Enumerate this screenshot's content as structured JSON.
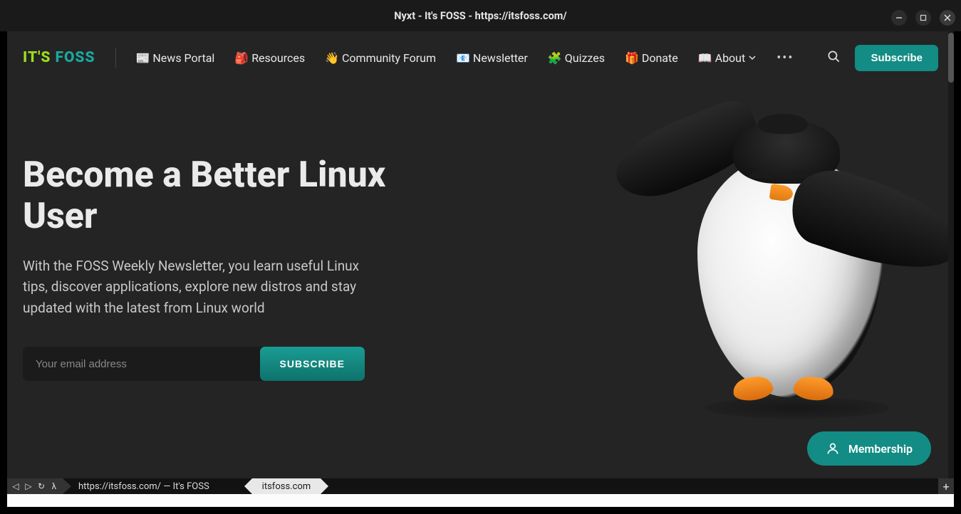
{
  "window": {
    "title": "Nyxt - It's FOSS - https://itsfoss.com/"
  },
  "logo": {
    "its": "IT'S",
    "foss": "FOSS"
  },
  "nav": {
    "items": [
      "📰 News Portal",
      "🎒 Resources",
      "👋 Community Forum",
      "📧 Newsletter",
      "🧩 Quizzes",
      "🎁 Donate",
      "📖 About"
    ]
  },
  "header": {
    "subscribe": "Subscribe"
  },
  "hero": {
    "title": "Become a Better Linux User",
    "desc": "With the FOSS Weekly Newsletter, you learn useful Linux tips, discover applications, explore new distros and stay updated with the latest from Linux world",
    "email_placeholder": "Your email address",
    "subscribe": "SUBSCRIBE"
  },
  "membership": {
    "label": "Membership"
  },
  "status": {
    "back": "◁",
    "forward": "▷",
    "reload": "↻",
    "lambda": "λ",
    "url": "https://itsfoss.com/ — It's FOSS",
    "tab": "itsfoss.com",
    "plus": "+"
  }
}
